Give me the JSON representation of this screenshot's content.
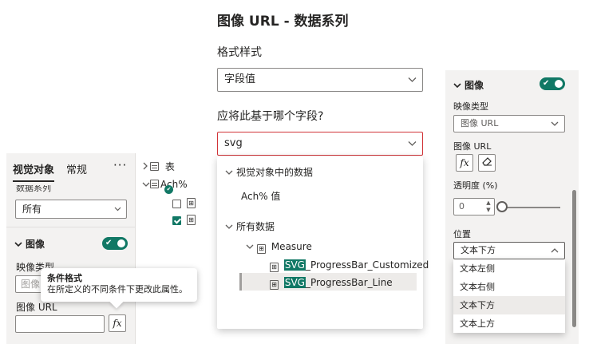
{
  "left_panel": {
    "tabs": [
      {
        "label": "视觉对象"
      },
      {
        "label": "常规"
      }
    ],
    "more_label": "···",
    "cut_label": "数据系列",
    "series_select": {
      "value": "所有"
    },
    "card": {
      "title": "图像",
      "toggle_on": true
    },
    "image_type_label": "映像类型",
    "image_type_value": "图像",
    "image_url_label": "图像 URL",
    "image_url_value": "",
    "fx_label": "fx"
  },
  "tooltip": {
    "title": "条件格式",
    "body": "在所定义的不同条件下更改此属性。"
  },
  "field_tree": {
    "table_label": "表",
    "measure_label": "Ach%"
  },
  "center": {
    "title": "图像 URL - 数据系列",
    "format_style_label": "格式样式",
    "format_style_value": "字段值",
    "field_question": "应将此基于哪个字段?",
    "field_value": "svg",
    "dropdown": {
      "section1": "视觉对象中的数据",
      "item1": "Ach% 值",
      "section2": "所有数据",
      "group": "Measure",
      "items": [
        {
          "highlight": "SVG",
          "rest": "_ProgressBar_Customized"
        },
        {
          "highlight": "SVG",
          "rest": "_ProgressBar_Line"
        }
      ]
    }
  },
  "right_panel": {
    "card_title": "图像",
    "toggle_on": true,
    "image_type_label": "映像类型",
    "image_type_value": "图像 URL",
    "image_url_label": "图像 URL",
    "fx_label": "fx",
    "transparency_label": "透明度 (%)",
    "transparency_value": "0",
    "transparency_level": 0,
    "position_label": "位置",
    "position_value": "文本下方",
    "position_options": [
      "文本左侧",
      "文本右侧",
      "文本下方",
      "文本上方"
    ],
    "position_selected_index": 2
  },
  "colors": {
    "accent": "#117865",
    "error_border": "#d13438",
    "panel_bg": "#f3f2f1"
  }
}
